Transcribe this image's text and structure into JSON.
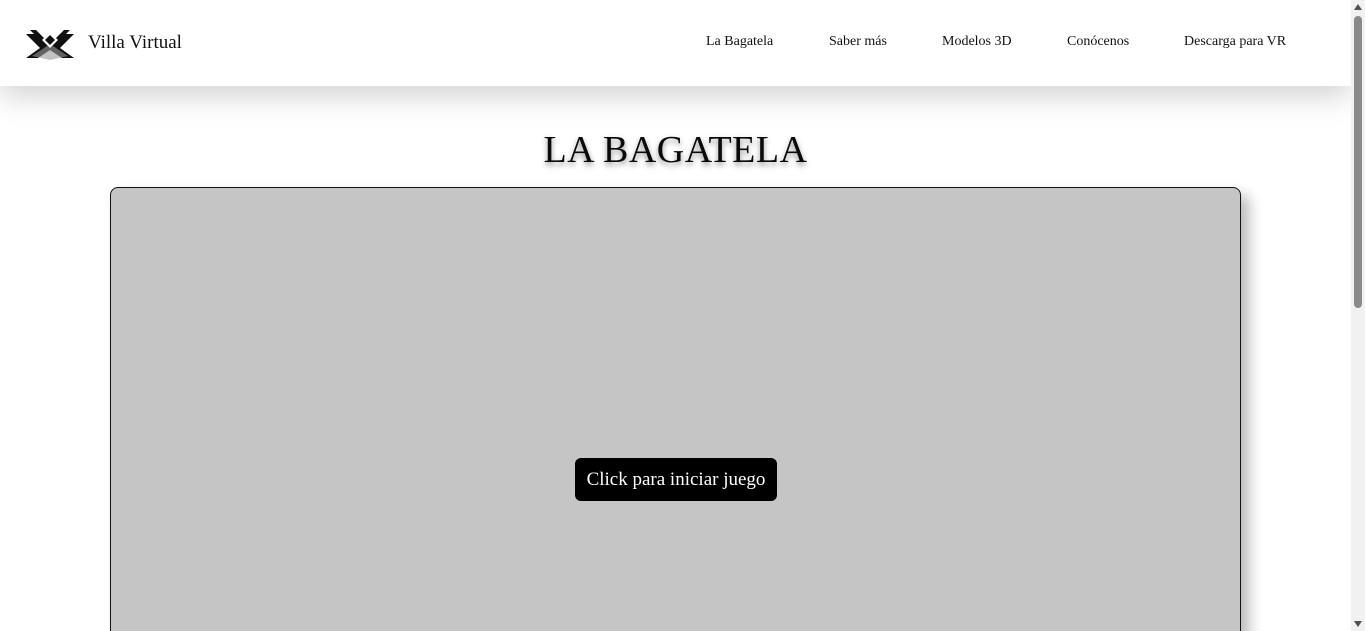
{
  "header": {
    "brand_name": "Villa Virtual",
    "logo_icon": "villa-virtual-logo",
    "nav": [
      {
        "label": "La Bagatela"
      },
      {
        "label": "Saber más"
      },
      {
        "label": "Modelos 3D"
      },
      {
        "label": "Conócenos"
      },
      {
        "label": "Descarga para VR"
      }
    ]
  },
  "main": {
    "title": "LA BAGATELA",
    "game": {
      "start_label": "Click para iniciar juego",
      "background_color": "#c6c5c6"
    }
  },
  "colors": {
    "header_bg": "#ffffff",
    "button_bg": "#000000",
    "button_text": "#ffffff"
  }
}
